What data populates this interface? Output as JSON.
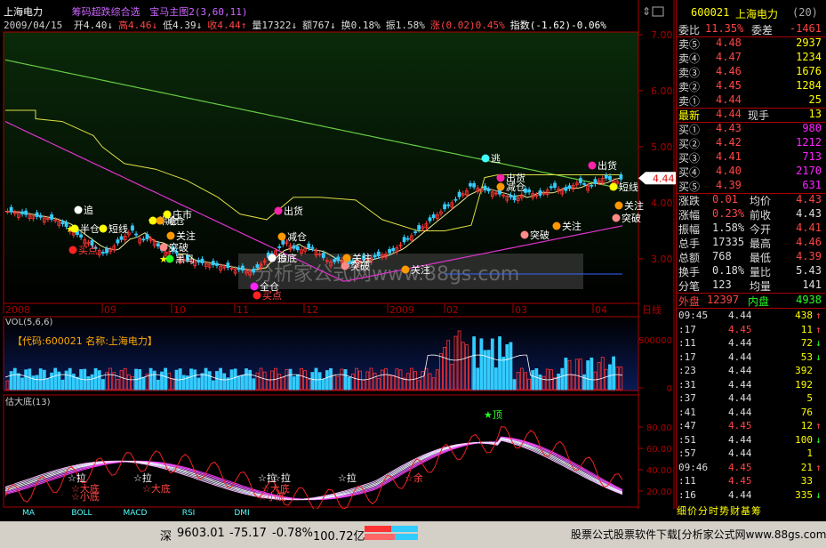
{
  "header": {
    "stock_name": "上海电力",
    "formula_name": "筹码超跌综合选",
    "indicator_name": "宝马主图2",
    "indicator_params": "(3,60,11)",
    "date": "2009/04/15",
    "ohlc": [
      {
        "label": "开",
        "value": "4.40",
        "color": "#ddd",
        "arrow": "↓"
      },
      {
        "label": "高",
        "value": "4.46",
        "color": "#f44",
        "arrow": "↓"
      },
      {
        "label": "低",
        "value": "4.39",
        "color": "#ddd",
        "arrow": "↓"
      },
      {
        "label": "收",
        "value": "4.44",
        "color": "#f44",
        "arrow": "↑"
      },
      {
        "label": "量",
        "value": "17322",
        "color": "#ddd",
        "arrow": "↓"
      },
      {
        "label": "额",
        "value": "767",
        "color": "#ddd",
        "arrow": "↓"
      },
      {
        "label": "换",
        "value": "0.18%",
        "color": "#ddd",
        "arrow": ""
      },
      {
        "label": "振",
        "value": "1.58%",
        "color": "#ddd",
        "arrow": ""
      },
      {
        "label": "涨",
        "value": "(0.02)0.45%",
        "color": "#f44",
        "arrow": ""
      },
      {
        "label": "指数",
        "value": "(-1.62)-0.06%",
        "color": "#fff",
        "arrow": ""
      }
    ]
  },
  "main_chart": {
    "price_ticks": [
      "7.00",
      "6.00",
      "5.00",
      "4.00",
      "3.00"
    ],
    "current_price_tag": "4.44",
    "date_labels": [
      "2008",
      "09",
      "10",
      "11",
      "12",
      "2009",
      "02",
      "03",
      "04"
    ],
    "right_label": "日线",
    "watermark": "分析家公式网www.88gs.com",
    "signals": [
      {
        "text": "追",
        "color": "#fff",
        "dot": "#fff"
      },
      {
        "text": "半仓",
        "color": "#fff",
        "dot": "#ff0"
      },
      {
        "text": "短线",
        "color": "#fff",
        "dot": "#ff0"
      },
      {
        "text": "买点",
        "color": "#f44",
        "dot": "#f22"
      },
      {
        "text": "半仓",
        "color": "#fff",
        "dot": "#ff0"
      },
      {
        "text": "减仓",
        "color": "#fff",
        "dot": "#f90"
      },
      {
        "text": "关注",
        "color": "#fff",
        "dot": "#f90"
      },
      {
        "text": "突破",
        "color": "#fff",
        "dot": "#f88"
      },
      {
        "text": "黑马",
        "color": "#fff",
        "dot": "#2f2"
      },
      {
        "text": "庄市",
        "color": "#fff",
        "dot": "#ff0"
      },
      {
        "text": "出货",
        "color": "#fff",
        "dot": "#f2a"
      },
      {
        "text": "减仓",
        "color": "#fff",
        "dot": "#f90"
      },
      {
        "text": "抄底",
        "color": "#fff",
        "dot": "#f2a"
      },
      {
        "text": "追",
        "color": "#fff",
        "dot": "#fff"
      },
      {
        "text": "全仓",
        "color": "#fff",
        "dot": "#f2f"
      },
      {
        "text": "买点",
        "color": "#f44",
        "dot": "#f22"
      },
      {
        "text": "关注",
        "color": "#fff",
        "dot": "#f90"
      },
      {
        "text": "突破",
        "color": "#fff",
        "dot": "#f88"
      },
      {
        "text": "关注",
        "color": "#fff",
        "dot": "#f90"
      },
      {
        "text": "逃",
        "color": "#fff",
        "dot": "#4ff"
      },
      {
        "text": "出货",
        "color": "#fff",
        "dot": "#f2a"
      },
      {
        "text": "减仓",
        "color": "#fff",
        "dot": "#f90"
      },
      {
        "text": "突破",
        "color": "#fff",
        "dot": "#f88"
      },
      {
        "text": "关注",
        "color": "#fff",
        "dot": "#f90"
      },
      {
        "text": "出货",
        "color": "#fff",
        "dot": "#f2a"
      },
      {
        "text": "短线",
        "color": "#fff",
        "dot": "#ff0"
      },
      {
        "text": "关注",
        "color": "#fff",
        "dot": "#f90"
      },
      {
        "text": "突破",
        "color": "#fff",
        "dot": "#f88"
      }
    ]
  },
  "volume_panel": {
    "title": "VOL(5,6,6)",
    "caption": "【代码:600021 名称:上海电力】",
    "ticks": [
      "500000",
      "0"
    ]
  },
  "oscillator_panel": {
    "title": "估大底(13)",
    "ticks": [
      "80.00",
      "60.00",
      "40.00",
      "20.00"
    ],
    "labels": [
      {
        "text": "☆拉",
        "color": "#fff"
      },
      {
        "text": "☆大底",
        "color": "#f44"
      },
      {
        "text": "☆小底",
        "color": "#f44"
      },
      {
        "text": "☆拉",
        "color": "#fff"
      },
      {
        "text": "☆大底",
        "color": "#f44"
      },
      {
        "text": "☆拉",
        "color": "#fff"
      },
      {
        "text": "☆大底",
        "color": "#f44"
      },
      {
        "text": "☆小底",
        "color": "#f44"
      },
      {
        "text": "☆拉",
        "color": "#fff"
      },
      {
        "text": "☆拉",
        "color": "#fff"
      },
      {
        "text": "☆余",
        "color": "#f44"
      },
      {
        "text": "★顶",
        "color": "#2f2"
      }
    ]
  },
  "bottom_tabs": [
    "MA",
    "BOLL",
    "MACD",
    "RSI",
    "DMI"
  ],
  "quote_panel": {
    "code": "600021",
    "name": "上海电力",
    "num": "(20)",
    "weibi_label": "委比",
    "weibi": "11.35%",
    "weicha_label": "委差",
    "weicha": "-1461",
    "sells": [
      {
        "label": "卖⑤",
        "price": "4.48",
        "vol": "2937"
      },
      {
        "label": "卖④",
        "price": "4.47",
        "vol": "1234"
      },
      {
        "label": "卖③",
        "price": "4.46",
        "vol": "1676"
      },
      {
        "label": "卖②",
        "price": "4.45",
        "vol": "1284"
      },
      {
        "label": "卖①",
        "price": "4.44",
        "vol": "25"
      }
    ],
    "latest_label": "最新",
    "latest": "4.44",
    "xianshou_label": "现手",
    "xianshou": "13",
    "buys": [
      {
        "label": "买①",
        "price": "4.43",
        "vol": "980"
      },
      {
        "label": "买②",
        "price": "4.42",
        "vol": "1212"
      },
      {
        "label": "买③",
        "price": "4.41",
        "vol": "713"
      },
      {
        "label": "买④",
        "price": "4.40",
        "vol": "2170"
      },
      {
        "label": "买⑤",
        "price": "4.39",
        "vol": "631"
      }
    ],
    "stats": [
      {
        "l1": "涨跌",
        "v1": "0.01",
        "c1": "#f44",
        "l2": "均价",
        "v2": "4.43",
        "c2": "#f44"
      },
      {
        "l1": "涨幅",
        "v1": "0.23%",
        "c1": "#f44",
        "l2": "前收",
        "v2": "4.43",
        "c2": "#ddd"
      },
      {
        "l1": "振幅",
        "v1": "1.58%",
        "c1": "#ddd",
        "l2": "今开",
        "v2": "4.41",
        "c2": "#f44"
      },
      {
        "l1": "总手",
        "v1": "17335",
        "c1": "#ddd",
        "l2": "最高",
        "v2": "4.46",
        "c2": "#f44"
      },
      {
        "l1": "总额",
        "v1": "768",
        "c1": "#ddd",
        "l2": "最低",
        "v2": "4.39",
        "c2": "#f44"
      },
      {
        "l1": "换手",
        "v1": "0.18%",
        "c1": "#ddd",
        "l2": "量比",
        "v2": "5.43",
        "c2": "#ddd"
      },
      {
        "l1": "分笔",
        "v1": "123",
        "c1": "#ddd",
        "l2": "均量",
        "v2": "141",
        "c2": "#ddd"
      }
    ],
    "waipan_label": "外盘",
    "waipan": "12397",
    "neipan_label": "内盘",
    "neipan": "4938",
    "ticks": [
      {
        "time": "09:45",
        "price": "4.44",
        "vol": "438",
        "arrow": "↑",
        "acolor": "#f44"
      },
      {
        "time": ":17",
        "price": "4.45",
        "vol": "11",
        "arrow": "↑",
        "acolor": "#f44"
      },
      {
        "time": ":11",
        "price": "4.44",
        "vol": "72",
        "arrow": "↓",
        "acolor": "#2f2"
      },
      {
        "time": ":17",
        "price": "4.44",
        "vol": "53",
        "arrow": "↓",
        "acolor": "#2f2"
      },
      {
        "time": ":23",
        "price": "4.44",
        "vol": "392",
        "arrow": "",
        "acolor": "#ddd"
      },
      {
        "time": ":31",
        "price": "4.44",
        "vol": "192",
        "arrow": "",
        "acolor": "#ddd"
      },
      {
        "time": ":37",
        "price": "4.44",
        "vol": "5",
        "arrow": "",
        "acolor": "#ddd"
      },
      {
        "time": ":41",
        "price": "4.44",
        "vol": "76",
        "arrow": "",
        "acolor": "#ddd"
      },
      {
        "time": ":47",
        "price": "4.45",
        "vol": "12",
        "arrow": "↑",
        "acolor": "#f44"
      },
      {
        "time": ":51",
        "price": "4.44",
        "vol": "100",
        "arrow": "↓",
        "acolor": "#2f2"
      },
      {
        "time": ":57",
        "price": "4.44",
        "vol": "1",
        "arrow": "",
        "acolor": "#ddd"
      },
      {
        "time": "09:46",
        "price": "4.45",
        "vol": "21",
        "arrow": "↑",
        "acolor": "#f44"
      },
      {
        "time": ":11",
        "price": "4.45",
        "vol": "33",
        "arrow": "",
        "acolor": "#ddd"
      },
      {
        "time": ":16",
        "price": "4.44",
        "vol": "335",
        "arrow": "↓",
        "acolor": "#2f2"
      }
    ],
    "bottom_tabs": "细价分时势财基筹"
  },
  "status_bar": {
    "index_name": "深",
    "index_value": "9603.01",
    "index_change": "-75.17",
    "index_pct": "-0.78%",
    "index_amount": "100.72亿",
    "ad_text": "股票公式股票软件下载[分析家公式网www.88gs.com]"
  }
}
